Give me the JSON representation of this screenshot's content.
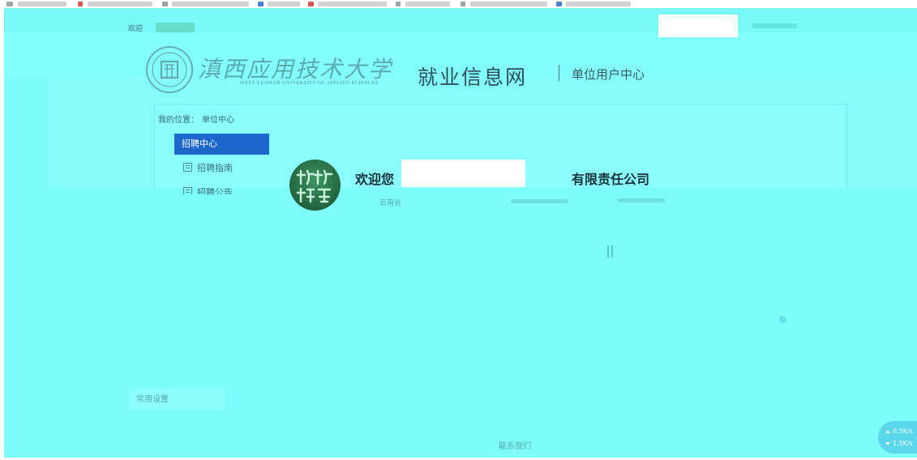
{
  "header": {
    "welcome": "欢迎"
  },
  "logo": {
    "name_cn": "滇西应用技术大学",
    "name_en": "WEST YUNNAN UNIVERSITY OF APPLIED SCIENCES"
  },
  "site": {
    "title": "就业信息网",
    "subtitle": "单位用户中心"
  },
  "breadcrumb": {
    "label": "我的位置：",
    "current": "单位中心"
  },
  "sidebar": {
    "section": "招聘中心",
    "items": [
      {
        "label": "招聘指南",
        "icon": "list-icon"
      },
      {
        "label": "招聘公告",
        "icon": "list-icon"
      }
    ]
  },
  "welcome": {
    "greeting": "欢迎您",
    "company_suffix": "有限责任公司"
  },
  "info": {
    "location": "云南省"
  },
  "settings": {
    "label": "常用设置"
  },
  "footer": {
    "link": "联系我们"
  },
  "netspeed": {
    "up": "0.5K/s",
    "down": "1.5K/s"
  },
  "colors": {
    "background": "#7efcfb",
    "accent": "#1c67cc",
    "text_dark": "#17323a"
  }
}
